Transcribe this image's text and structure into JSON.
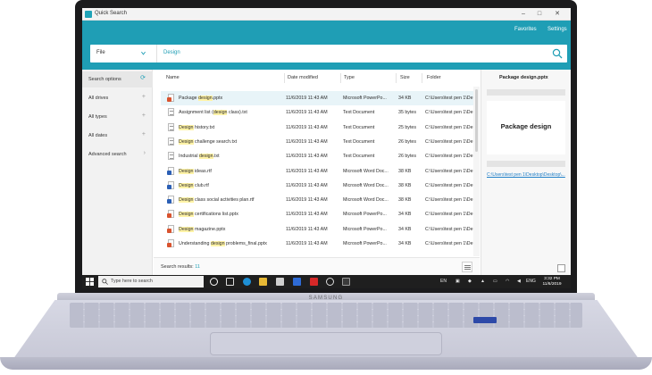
{
  "window": {
    "title": "Quick Search",
    "minimize": "–",
    "maximize": "□",
    "close": "✕"
  },
  "header": {
    "favorites": "Favorites",
    "settings": "Settings"
  },
  "search": {
    "scope": "File",
    "query": "Design"
  },
  "sidebar": {
    "items": [
      {
        "label": "Search options",
        "mark": "⟳"
      },
      {
        "label": "All drives",
        "mark": "+"
      },
      {
        "label": "All types",
        "mark": "+"
      },
      {
        "label": "All dates",
        "mark": "+"
      },
      {
        "label": "Advanced search",
        "mark": "›"
      }
    ]
  },
  "table": {
    "columns": [
      "Name",
      "Date modified",
      "Type",
      "Size",
      "Folder"
    ],
    "rows": [
      {
        "pre": "Package ",
        "hl": "design",
        "post": ".pptx",
        "date": "11/6/2019 11:43 AM",
        "type": "Microsoft PowerPo...",
        "size": "34 KB",
        "folder": "C:\\Users\\test pen 1\\De",
        "icon": "ppt"
      },
      {
        "pre": "Assignment list (",
        "hl": "design",
        "post": " class).txt",
        "date": "11/6/2019 11:43 AM",
        "type": "Text Document",
        "size": "35 bytes",
        "folder": "C:\\Users\\test pen 1\\De",
        "icon": "txt"
      },
      {
        "pre": "",
        "hl": "Design",
        "post": " history.txt",
        "date": "11/6/2019 11:43 AM",
        "type": "Text Document",
        "size": "25 bytes",
        "folder": "C:\\Users\\test pen 1\\De",
        "icon": "txt"
      },
      {
        "pre": "",
        "hl": "Design",
        "post": " challenge search.txt",
        "date": "11/6/2019 11:43 AM",
        "type": "Text Document",
        "size": "26 bytes",
        "folder": "C:\\Users\\test pen 1\\De",
        "icon": "txt"
      },
      {
        "pre": "Industrial ",
        "hl": "design",
        "post": ".txt",
        "date": "11/6/2019 11:43 AM",
        "type": "Text Document",
        "size": "26 bytes",
        "folder": "C:\\Users\\test pen 1\\De",
        "icon": "txt"
      },
      {
        "pre": "",
        "hl": "Design",
        "post": " ideas.rtf",
        "date": "11/6/2019 11:43 AM",
        "type": "Microsoft Word Doc...",
        "size": "38 KB",
        "folder": "C:\\Users\\test pen 1\\De",
        "icon": "doc"
      },
      {
        "pre": "",
        "hl": "Design",
        "post": " club.rtf",
        "date": "11/6/2019 11:43 AM",
        "type": "Microsoft Word Doc...",
        "size": "38 KB",
        "folder": "C:\\Users\\test pen 1\\De",
        "icon": "doc"
      },
      {
        "pre": "",
        "hl": "Design",
        "post": " class social activities plan.rtf",
        "date": "11/6/2019 11:43 AM",
        "type": "Microsoft Word Doc...",
        "size": "38 KB",
        "folder": "C:\\Users\\test pen 1\\De",
        "icon": "doc"
      },
      {
        "pre": "",
        "hl": "Design",
        "post": " certifications list.pptx",
        "date": "11/6/2019 11:43 AM",
        "type": "Microsoft PowerPo...",
        "size": "34 KB",
        "folder": "C:\\Users\\test pen 1\\De",
        "icon": "ppt"
      },
      {
        "pre": "",
        "hl": "Design",
        "post": " magazine.pptx",
        "date": "11/6/2019 11:43 AM",
        "type": "Microsoft PowerPo...",
        "size": "34 KB",
        "folder": "C:\\Users\\test pen 1\\De",
        "icon": "ppt"
      },
      {
        "pre": "Understanding ",
        "hl": "design",
        "post": " problems_final.pptx",
        "date": "11/6/2019 11:43 AM",
        "type": "Microsoft PowerPo...",
        "size": "34 KB",
        "folder": "C:\\Users\\test pen 1\\De",
        "icon": "ppt"
      }
    ]
  },
  "footer": {
    "label": "Search results:",
    "count": "11"
  },
  "preview": {
    "title": "Package design.pptx",
    "slide_text": "Package design",
    "path": "C:\\Users\\test pen 1\\Desktop\\Desktop\\..."
  },
  "taskbar": {
    "search_placeholder": "Type here to search",
    "lang1": "EN",
    "lang2": "ENG",
    "time": "3:32 PM",
    "date": "11/6/2019"
  },
  "device": {
    "brand": "SAMSUNG"
  },
  "colors": {
    "accent": "#1f9eb5",
    "highlight": "#fff3a6",
    "link": "#1f7fc7"
  }
}
